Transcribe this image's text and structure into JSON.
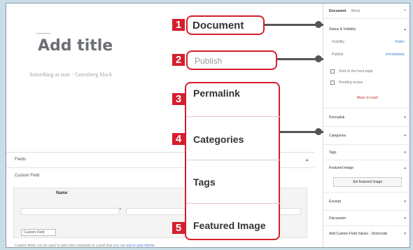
{
  "editor": {
    "title_placeholder": "Add title",
    "blurb": "Something at start · Gutenberg block"
  },
  "custom_fields": {
    "panel_title": "Fields",
    "toggle_icon": "chevron-up-icon",
    "subtitle": "Custom Field",
    "column_name": "Name",
    "remove_icon": "close-icon",
    "add_button": "Custom Field",
    "footer_text": "Custom fields can be used to add extra metadata to a post that you can",
    "footer_link": "use in your theme."
  },
  "sidebar": {
    "tab_document": "Document",
    "tab_block": "Block",
    "close_icon": "close-icon",
    "status_section": "Status & Visibility",
    "visibility_label": "Visibility",
    "visibility_value": "Public",
    "publish_label": "Publish",
    "publish_value": "Immediately",
    "stick_label": "Stick to the front page",
    "pending_label": "Pending review",
    "trash_button": "Move to trash",
    "permalink": "Permalink",
    "categories": "Categories",
    "tags": "Tags",
    "featured_image": "Featured image",
    "set_featured": "Set featured image",
    "excerpt": "Excerpt",
    "discussion": "Discussion",
    "acf_section": "Add Custom Field Values - Shortcode"
  },
  "callouts": [
    {
      "number": "1",
      "label": "Document"
    },
    {
      "number": "2",
      "label": "Publish"
    },
    {
      "number": "3",
      "label": "Permalink"
    },
    {
      "number": "4",
      "label": "Categories"
    },
    {
      "number": "",
      "label": "Tags"
    },
    {
      "number": "5",
      "label": "Featured Image"
    }
  ],
  "colors": {
    "accent": "#d41f2d",
    "background": "#c9dde6",
    "connector": "#555555"
  }
}
